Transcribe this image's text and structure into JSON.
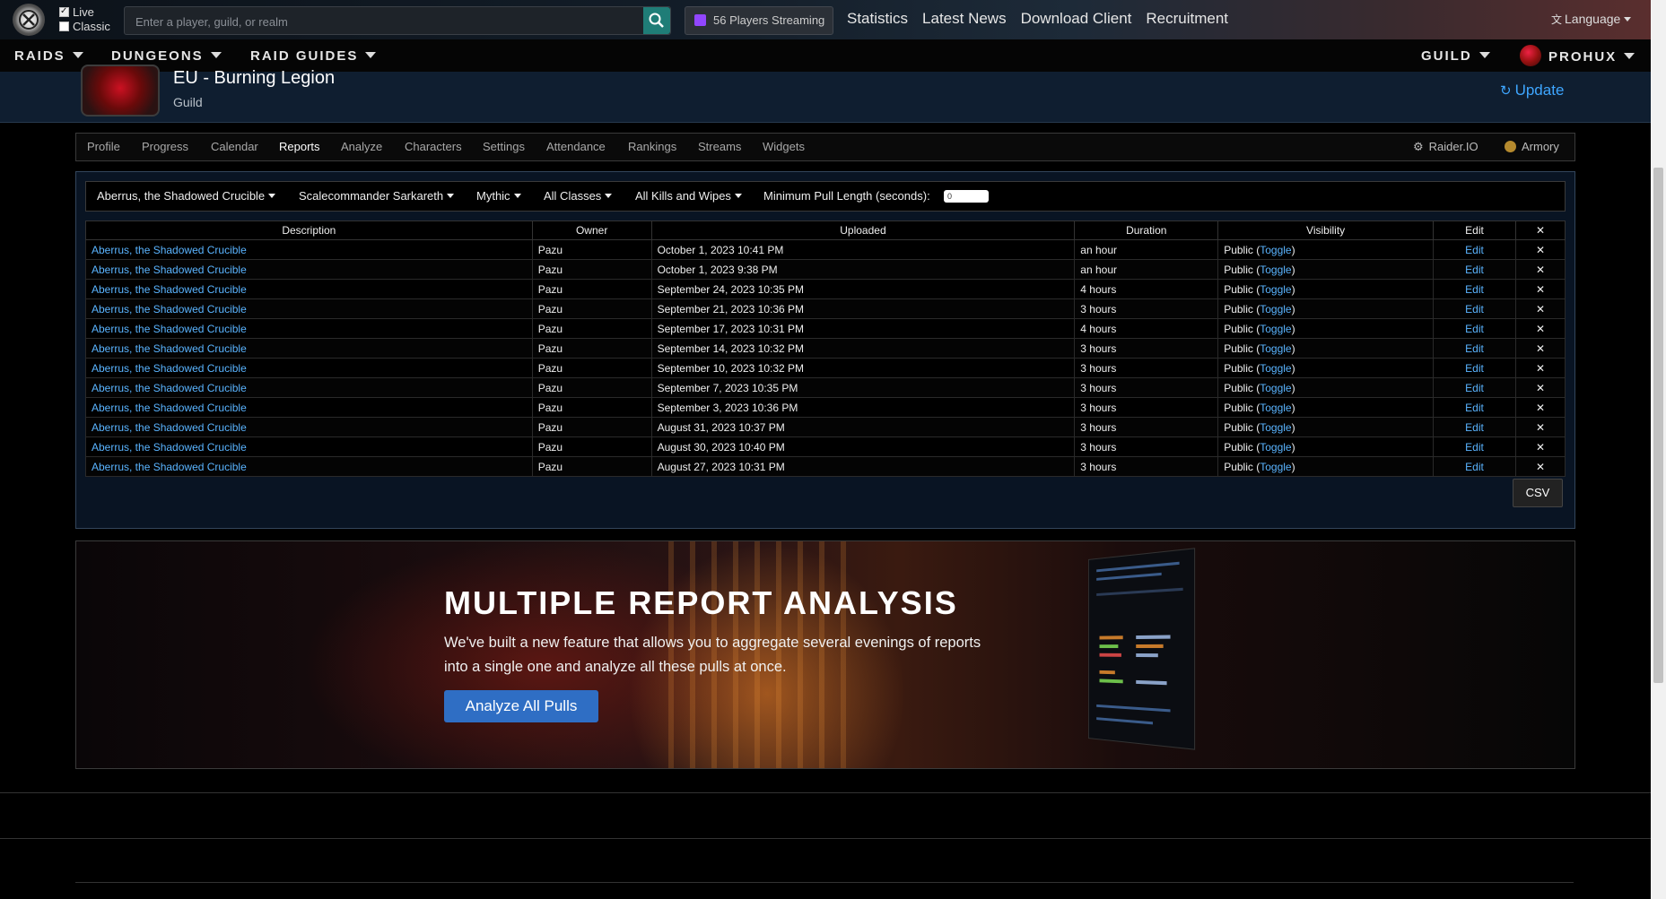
{
  "header": {
    "modes": [
      {
        "label": "Live",
        "checked": true
      },
      {
        "label": "Classic",
        "checked": false
      }
    ],
    "search": {
      "placeholder": "Enter a player, guild, or realm",
      "value": ""
    },
    "streaming": "56 Players Streaming",
    "nav": [
      "Statistics",
      "Latest News",
      "Download Client",
      "Recruitment"
    ],
    "language": "Language"
  },
  "mainnav": {
    "raids": "RAIDS",
    "dungeons": "DUNGEONS",
    "raid_guides": "RAID GUIDES",
    "guild": "GUILD",
    "user": "PROHUX"
  },
  "guild": {
    "title": "EU - Burning Legion",
    "subtitle": "Guild",
    "update": "Update"
  },
  "tabs": [
    "Profile",
    "Progress",
    "Calendar",
    "Reports",
    "Analyze",
    "Characters",
    "Settings",
    "Attendance",
    "Rankings",
    "Streams",
    "Widgets"
  ],
  "active_tab": "Reports",
  "external": {
    "raiderio": "Raider.IO",
    "armory": "Armory"
  },
  "filters": {
    "zone": "Aberrus, the Shadowed Crucible",
    "boss": "Scalecommander Sarkareth",
    "difficulty": "Mythic",
    "classes": "All Classes",
    "kills": "All Kills and Wipes",
    "min_pull_label": "Minimum Pull Length (seconds):",
    "min_pull_value": "0"
  },
  "table": {
    "headers": [
      "Description",
      "Owner",
      "Uploaded",
      "Duration",
      "Visibility",
      "Edit",
      "✕"
    ],
    "rows": [
      {
        "desc": "Aberrus, the Shadowed Crucible",
        "owner": "Pazu",
        "uploaded": "October 1, 2023 10:41 PM",
        "duration": "an hour",
        "visibility": "Public",
        "toggle": "Toggle",
        "edit": "Edit"
      },
      {
        "desc": "Aberrus, the Shadowed Crucible",
        "owner": "Pazu",
        "uploaded": "October 1, 2023 9:38 PM",
        "duration": "an hour",
        "visibility": "Public",
        "toggle": "Toggle",
        "edit": "Edit"
      },
      {
        "desc": "Aberrus, the Shadowed Crucible",
        "owner": "Pazu",
        "uploaded": "September 24, 2023 10:35 PM",
        "duration": "4 hours",
        "visibility": "Public",
        "toggle": "Toggle",
        "edit": "Edit"
      },
      {
        "desc": "Aberrus, the Shadowed Crucible",
        "owner": "Pazu",
        "uploaded": "September 21, 2023 10:36 PM",
        "duration": "3 hours",
        "visibility": "Public",
        "toggle": "Toggle",
        "edit": "Edit"
      },
      {
        "desc": "Aberrus, the Shadowed Crucible",
        "owner": "Pazu",
        "uploaded": "September 17, 2023 10:31 PM",
        "duration": "4 hours",
        "visibility": "Public",
        "toggle": "Toggle",
        "edit": "Edit"
      },
      {
        "desc": "Aberrus, the Shadowed Crucible",
        "owner": "Pazu",
        "uploaded": "September 14, 2023 10:32 PM",
        "duration": "3 hours",
        "visibility": "Public",
        "toggle": "Toggle",
        "edit": "Edit"
      },
      {
        "desc": "Aberrus, the Shadowed Crucible",
        "owner": "Pazu",
        "uploaded": "September 10, 2023 10:32 PM",
        "duration": "3 hours",
        "visibility": "Public",
        "toggle": "Toggle",
        "edit": "Edit"
      },
      {
        "desc": "Aberrus, the Shadowed Crucible",
        "owner": "Pazu",
        "uploaded": "September 7, 2023 10:35 PM",
        "duration": "3 hours",
        "visibility": "Public",
        "toggle": "Toggle",
        "edit": "Edit"
      },
      {
        "desc": "Aberrus, the Shadowed Crucible",
        "owner": "Pazu",
        "uploaded": "September 3, 2023 10:36 PM",
        "duration": "3 hours",
        "visibility": "Public",
        "toggle": "Toggle",
        "edit": "Edit"
      },
      {
        "desc": "Aberrus, the Shadowed Crucible",
        "owner": "Pazu",
        "uploaded": "August 31, 2023 10:37 PM",
        "duration": "3 hours",
        "visibility": "Public",
        "toggle": "Toggle",
        "edit": "Edit"
      },
      {
        "desc": "Aberrus, the Shadowed Crucible",
        "owner": "Pazu",
        "uploaded": "August 30, 2023 10:40 PM",
        "duration": "3 hours",
        "visibility": "Public",
        "toggle": "Toggle",
        "edit": "Edit"
      },
      {
        "desc": "Aberrus, the Shadowed Crucible",
        "owner": "Pazu",
        "uploaded": "August 27, 2023 10:31 PM",
        "duration": "3 hours",
        "visibility": "Public",
        "toggle": "Toggle",
        "edit": "Edit"
      }
    ],
    "csv": "CSV"
  },
  "promo": {
    "title": "MULTIPLE REPORT ANALYSIS",
    "text": "We've built a new feature that allows you to aggregate several evenings of reports into a single one and analyze all these pulls at once.",
    "button": "Analyze All Pulls"
  },
  "colors": {
    "link": "#5ab4ff",
    "accent": "#2f6ec4",
    "panel": "#091423",
    "update": "#3ea6ff"
  },
  "icons": [
    "site-logo-icon",
    "search-icon",
    "twitch-icon",
    "translate-icon",
    "refresh-icon",
    "raiderio-icon",
    "armory-icon",
    "close-icon"
  ]
}
